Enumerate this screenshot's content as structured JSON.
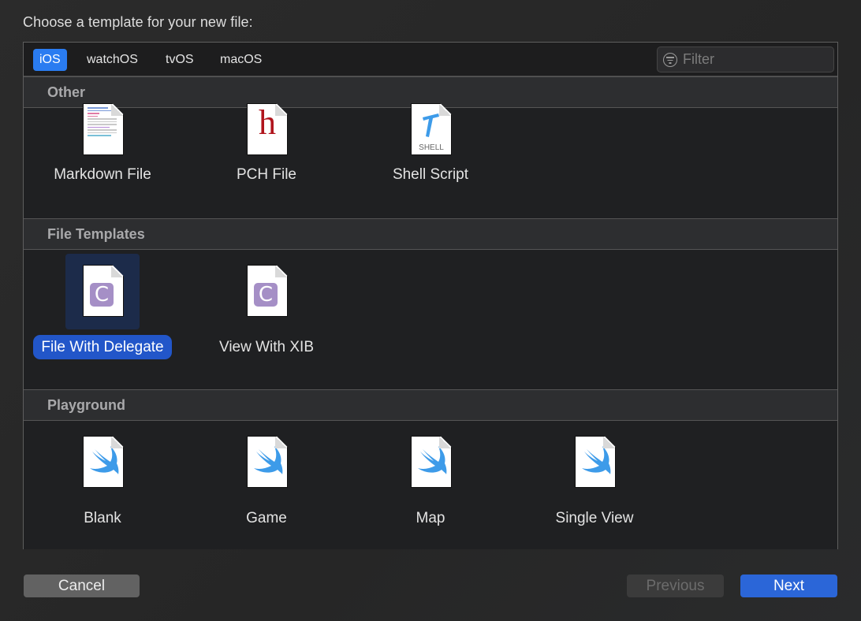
{
  "prompt": "Choose a template for your new file:",
  "platform_tabs": [
    {
      "label": "iOS",
      "active": true
    },
    {
      "label": "watchOS",
      "active": false
    },
    {
      "label": "tvOS",
      "active": false
    },
    {
      "label": "macOS",
      "active": false
    }
  ],
  "filter": {
    "placeholder": "Filter",
    "value": "",
    "icon": "filter-icon"
  },
  "sections": [
    {
      "title": "Other",
      "items": [
        {
          "label": "Markdown File",
          "icon": "markdown-file-icon"
        },
        {
          "label": "PCH File",
          "icon": "pch-file-icon",
          "glyph": "h"
        },
        {
          "label": "Shell Script",
          "icon": "shell-script-icon",
          "glyph": "SHELL"
        }
      ]
    },
    {
      "title": "File Templates",
      "items": [
        {
          "label": "File With Delegate",
          "icon": "c-file-icon",
          "glyph": "C",
          "selected": true
        },
        {
          "label": "View With XIB",
          "icon": "c-file-icon",
          "glyph": "C"
        }
      ]
    },
    {
      "title": "Playground",
      "items": [
        {
          "label": "Blank",
          "icon": "swift-file-icon"
        },
        {
          "label": "Game",
          "icon": "swift-file-icon"
        },
        {
          "label": "Map",
          "icon": "swift-file-icon"
        },
        {
          "label": "Single View",
          "icon": "swift-file-icon"
        }
      ]
    }
  ],
  "buttons": {
    "cancel": "Cancel",
    "previous": "Previous",
    "next": "Next"
  },
  "colors": {
    "accent": "#2a7cf1",
    "selection": "#2256c9",
    "next_button": "#2b66d8",
    "swift": "#3d9be9",
    "c_badge": "#a58fc6",
    "pch": "#b0141c"
  }
}
